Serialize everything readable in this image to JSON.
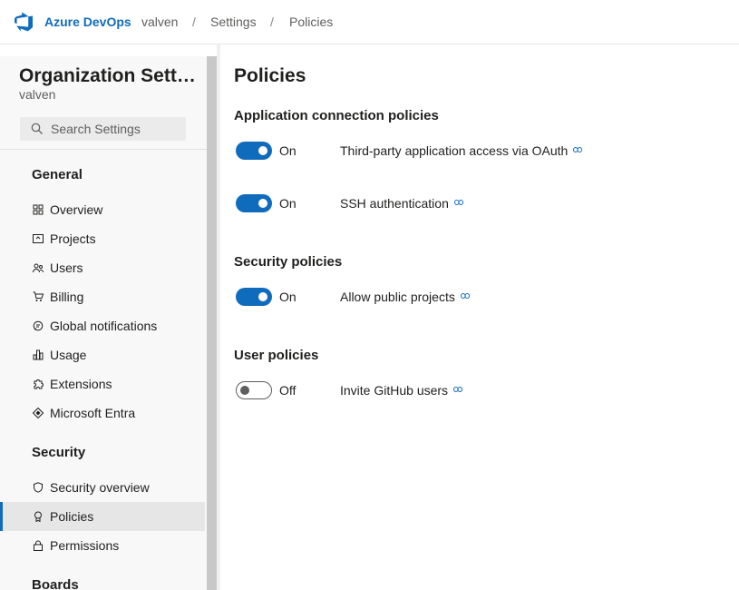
{
  "header": {
    "brand": "Azure DevOps",
    "breadcrumbs": [
      "valven",
      "Settings",
      "Policies"
    ],
    "separator": "/"
  },
  "sidebar": {
    "title": "Organization Setti…",
    "subtitle": "valven",
    "search_placeholder": "Search Settings",
    "sections": [
      {
        "heading": "General",
        "items": [
          {
            "label": "Overview",
            "icon": "overview-icon"
          },
          {
            "label": "Projects",
            "icon": "projects-icon"
          },
          {
            "label": "Users",
            "icon": "users-icon"
          },
          {
            "label": "Billing",
            "icon": "billing-cart-icon"
          },
          {
            "label": "Global notifications",
            "icon": "notifications-icon"
          },
          {
            "label": "Usage",
            "icon": "usage-icon"
          },
          {
            "label": "Extensions",
            "icon": "extensions-icon"
          },
          {
            "label": "Microsoft Entra",
            "icon": "entra-icon"
          }
        ]
      },
      {
        "heading": "Security",
        "items": [
          {
            "label": "Security overview",
            "icon": "shield-icon"
          },
          {
            "label": "Policies",
            "icon": "policies-icon",
            "selected": true
          },
          {
            "label": "Permissions",
            "icon": "lock-icon"
          }
        ]
      },
      {
        "heading": "Boards",
        "items": []
      }
    ]
  },
  "main": {
    "title": "Policies",
    "groups": [
      {
        "heading": "Application connection policies",
        "policies": [
          {
            "state": "On",
            "enabled": true,
            "label": "Third-party application access via OAuth"
          },
          {
            "state": "On",
            "enabled": true,
            "label": "SSH authentication"
          }
        ]
      },
      {
        "heading": "Security policies",
        "policies": [
          {
            "state": "On",
            "enabled": true,
            "label": "Allow public projects"
          }
        ]
      },
      {
        "heading": "User policies",
        "policies": [
          {
            "state": "Off",
            "enabled": false,
            "label": "Invite GitHub users"
          }
        ]
      }
    ]
  },
  "colors": {
    "accent": "#0f6cbd",
    "text": "#201f1e",
    "muted": "#605e5c"
  }
}
